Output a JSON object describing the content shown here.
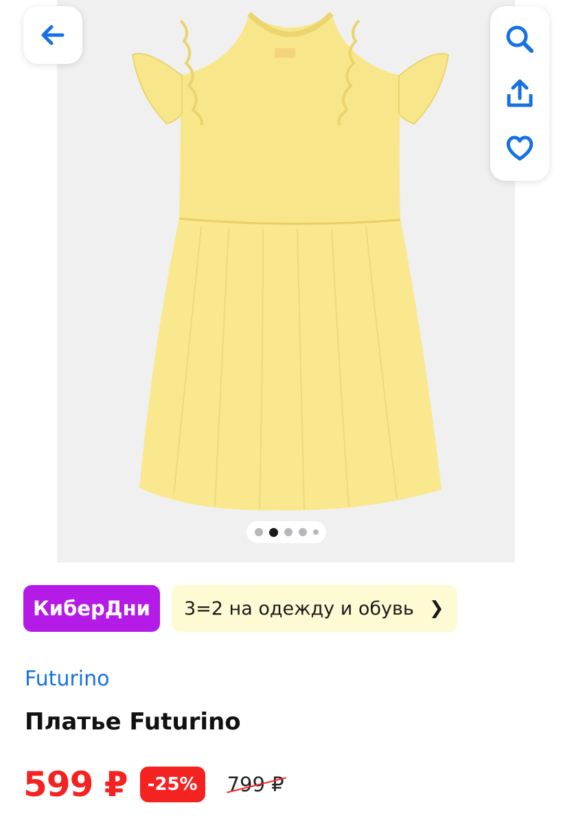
{
  "gallery": {
    "image_alt": "Yellow ribbed girls dress with ruffled sleeves",
    "dress_color": "#f9e88e",
    "background_color": "#f0f0f1",
    "dots_total": 5,
    "dots_active_index": 1
  },
  "navigation": {
    "back_icon": "arrow-left-icon",
    "actions": [
      "search-icon",
      "share-icon",
      "heart-icon"
    ],
    "accent_color": "#1671e3"
  },
  "promo": {
    "badge_label": "КиберДни",
    "badge_color": "#b51be6",
    "offer_label": "3=2 на одежду и обувь",
    "offer_color": "#fefad3"
  },
  "product": {
    "brand": "Futurino",
    "title": "Платье Futurino",
    "price": "599 ₽",
    "discount": "-25%",
    "old_price": "799 ₽",
    "price_color": "#f52222"
  }
}
